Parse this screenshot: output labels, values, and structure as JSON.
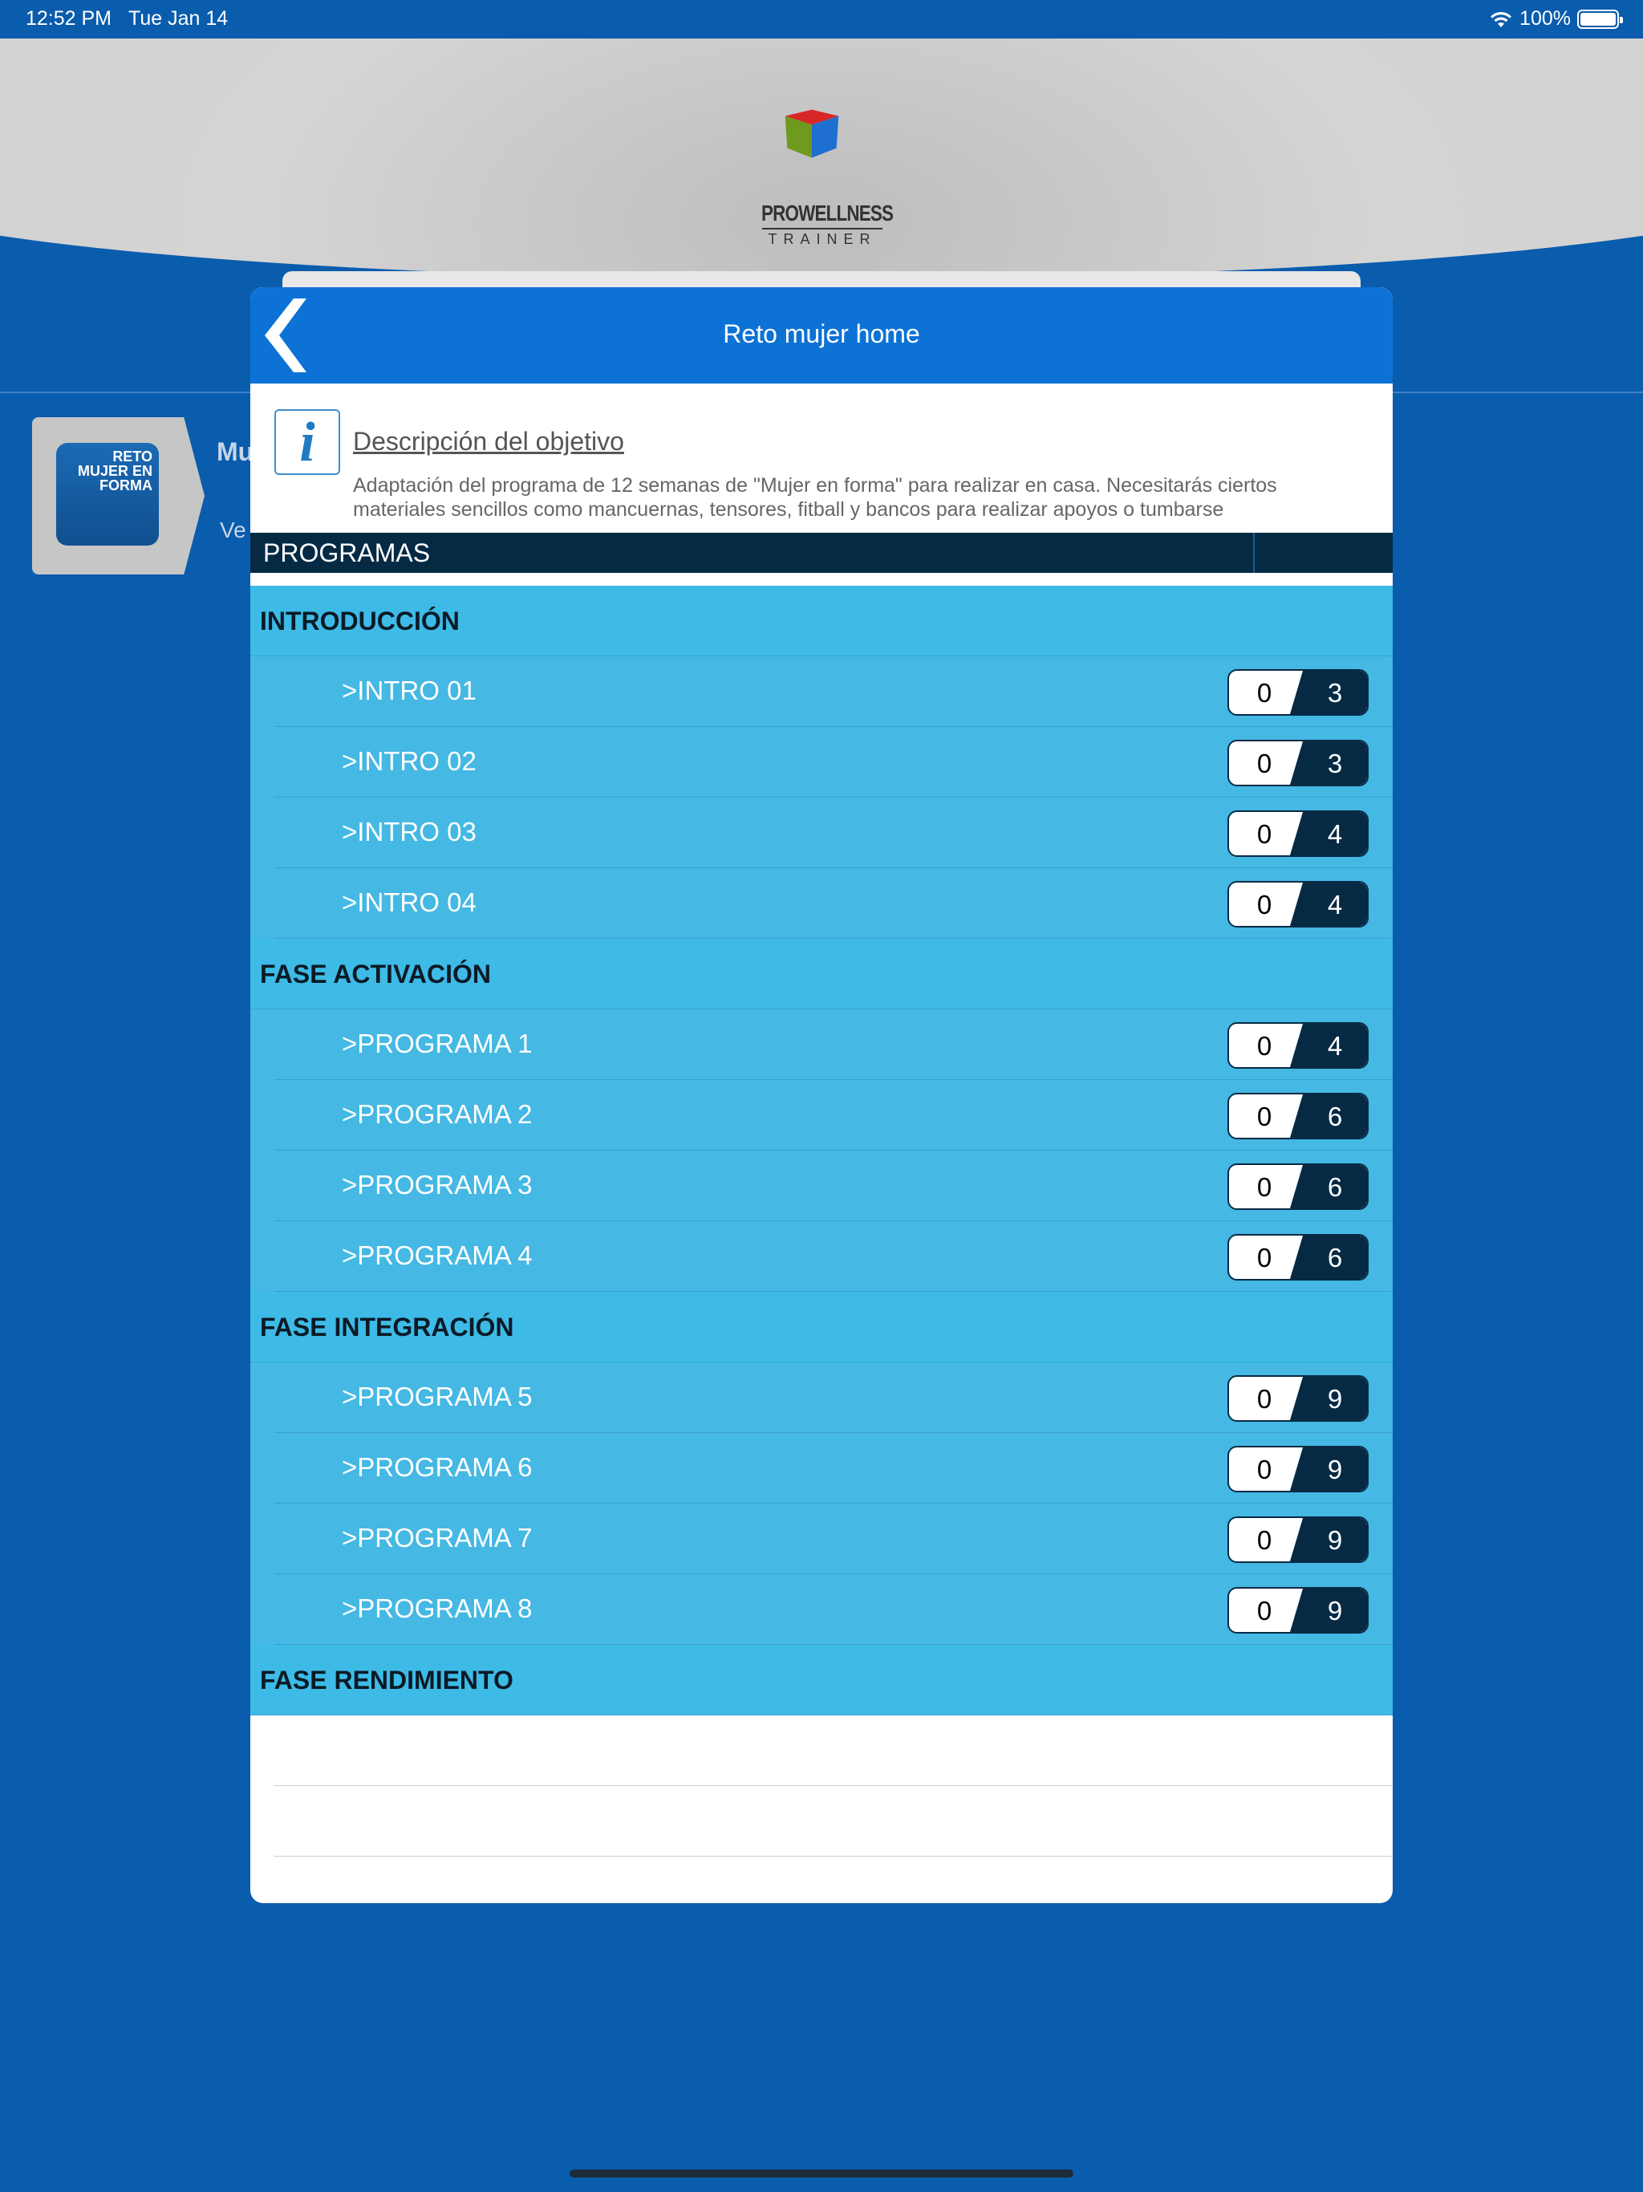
{
  "status_bar": {
    "time": "12:52 PM",
    "date": "Tue Jan 14",
    "battery": "100%"
  },
  "brand": {
    "name_line1": "PROWELLNESS",
    "name_line2": "TRAINER"
  },
  "background_item": {
    "thumb_text": "RETO MUJER EN FORMA",
    "title": "Mu",
    "subtitle": "Ve"
  },
  "modal": {
    "title": "Reto mujer home",
    "info_title": "Descripción del objetivo",
    "info_description": "Adaptación del programa de 12 semanas de \"Mujer en forma\" para realizar en casa. Necesitarás ciertos materiales sencillos como mancuernas, tensores, fitball y bancos para realizar apoyos o tumbarse",
    "programs_label": "PROGRAMAS"
  },
  "sections": [
    {
      "title": "INTRODUCCIÓN",
      "rows": [
        {
          "label": ">INTRO 01",
          "done": "0",
          "total": "3"
        },
        {
          "label": ">INTRO 02",
          "done": "0",
          "total": "3"
        },
        {
          "label": ">INTRO 03",
          "done": "0",
          "total": "4"
        },
        {
          "label": ">INTRO 04",
          "done": "0",
          "total": "4"
        }
      ]
    },
    {
      "title": "FASE ACTIVACIÓN",
      "rows": [
        {
          "label": ">PROGRAMA 1",
          "done": "0",
          "total": "4"
        },
        {
          "label": ">PROGRAMA 2",
          "done": "0",
          "total": "6"
        },
        {
          "label": ">PROGRAMA 3",
          "done": "0",
          "total": "6"
        },
        {
          "label": ">PROGRAMA 4",
          "done": "0",
          "total": "6"
        }
      ]
    },
    {
      "title": "FASE INTEGRACIÓN",
      "rows": [
        {
          "label": ">PROGRAMA 5",
          "done": "0",
          "total": "9"
        },
        {
          "label": ">PROGRAMA 6",
          "done": "0",
          "total": "9"
        },
        {
          "label": ">PROGRAMA 7",
          "done": "0",
          "total": "9"
        },
        {
          "label": ">PROGRAMA 8",
          "done": "0",
          "total": "9"
        }
      ]
    },
    {
      "title": "FASE RENDIMIENTO",
      "rows": []
    }
  ],
  "colors": {
    "app_blue": "#0a5cad",
    "header_blue": "#0d72d6",
    "section_cyan": "#3dbbe6",
    "row_cyan": "#45b8e3",
    "dark_navy": "#062a44"
  }
}
